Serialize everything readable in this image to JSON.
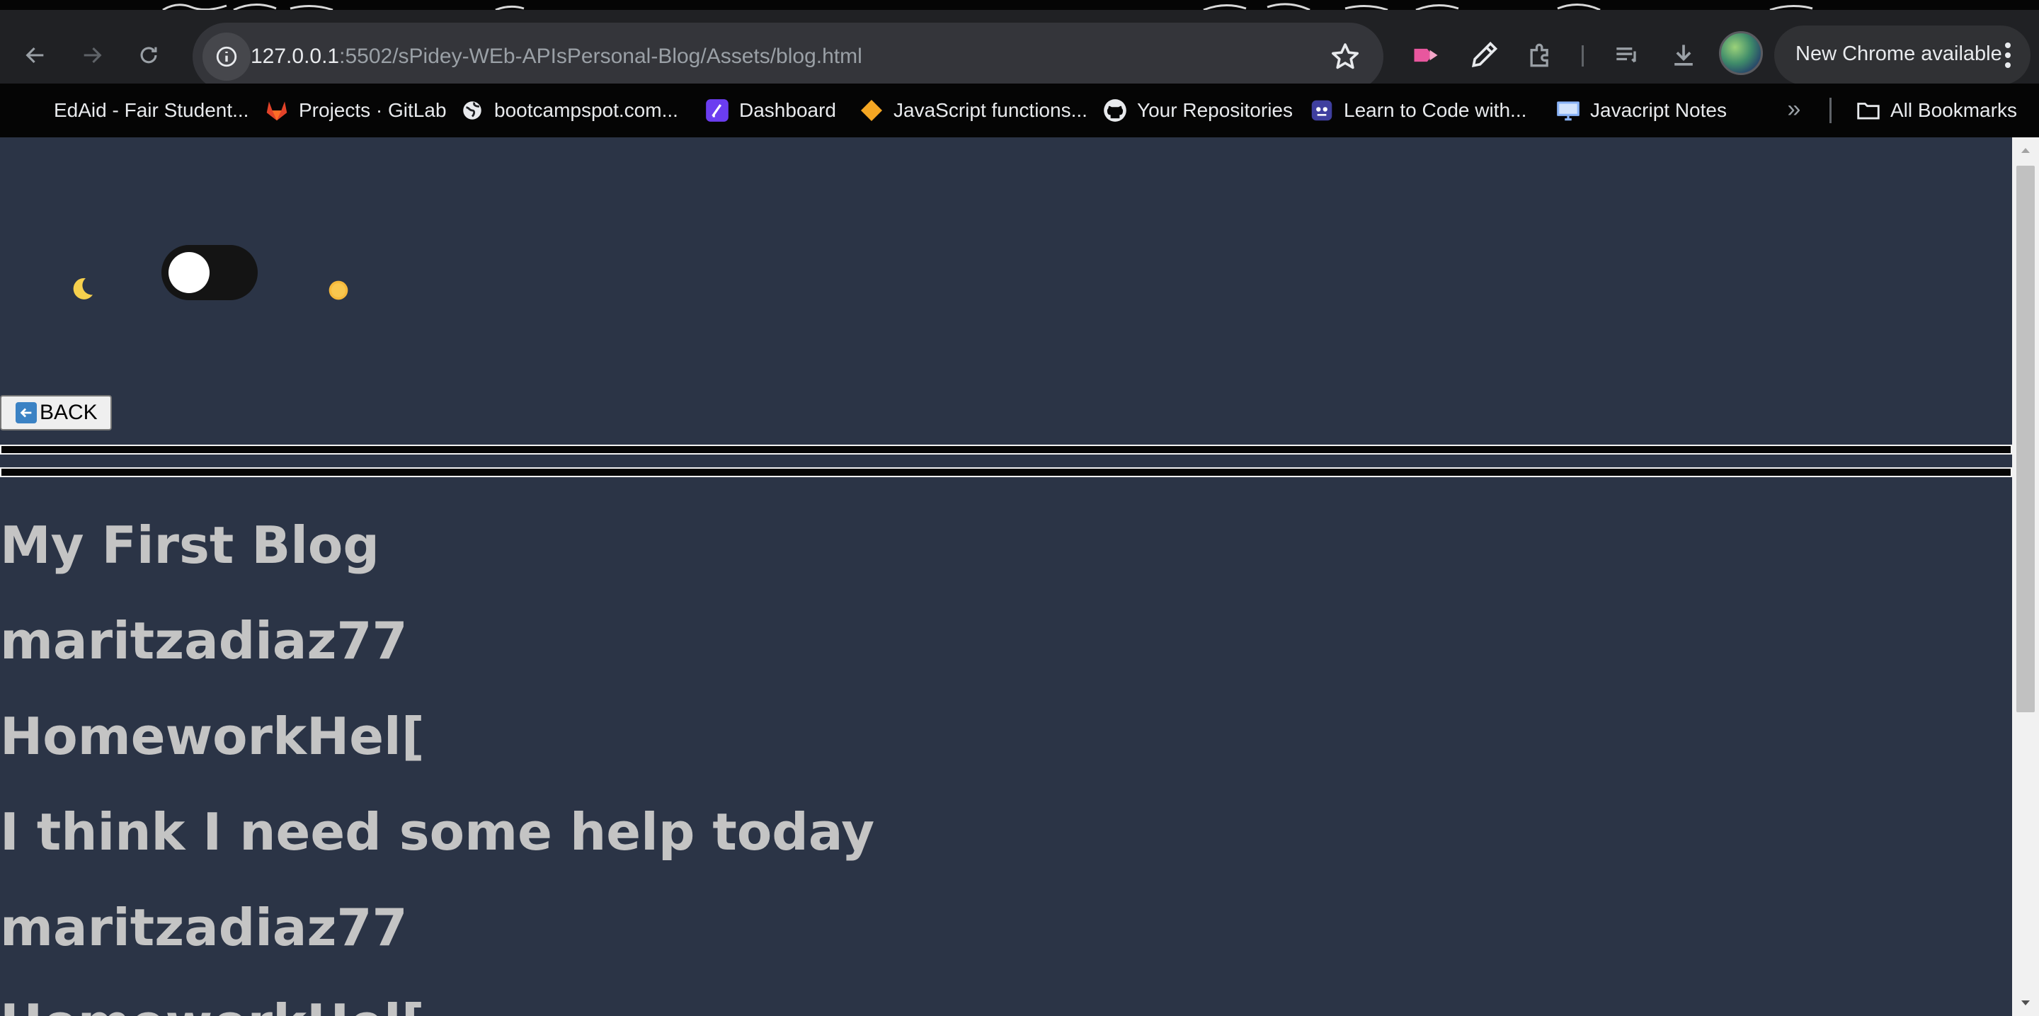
{
  "browser": {
    "url_host": "127.0.0.1",
    "url_path": ":5502/sPidey-WEb-APIsPersonal-Blog/Assets/blog.html",
    "update_label": "New Chrome available"
  },
  "bookmarks": [
    {
      "label": "EdAid - Fair Student...",
      "icon": "none"
    },
    {
      "label": "Projects · GitLab",
      "icon": "gitlab-icon"
    },
    {
      "label": "bootcampspot.com...",
      "icon": "globe-icon"
    },
    {
      "label": "Dashboard",
      "icon": "dashboard-icon"
    },
    {
      "label": "JavaScript functions...",
      "icon": "diamond-icon"
    },
    {
      "label": "Your Repositories",
      "icon": "github-icon"
    },
    {
      "label": "Learn to Code with...",
      "icon": "robot-icon"
    },
    {
      "label": "Javacript Notes",
      "icon": "monitor-icon"
    }
  ],
  "all_bookmarks_label": "All Bookmarks",
  "page": {
    "back_label": "BACK",
    "theme_icons": [
      "moon-icon",
      "sun-icon"
    ],
    "posts": [
      "My First Blog",
      "maritzadiaz77",
      "HomeworkHel[",
      "I think I need some help today",
      "maritzadiaz77",
      "HomeworkHel["
    ]
  },
  "colors": {
    "page_bg": "#2b3446",
    "post_text": "#c4c4c4",
    "chrome_bg": "#202124"
  }
}
